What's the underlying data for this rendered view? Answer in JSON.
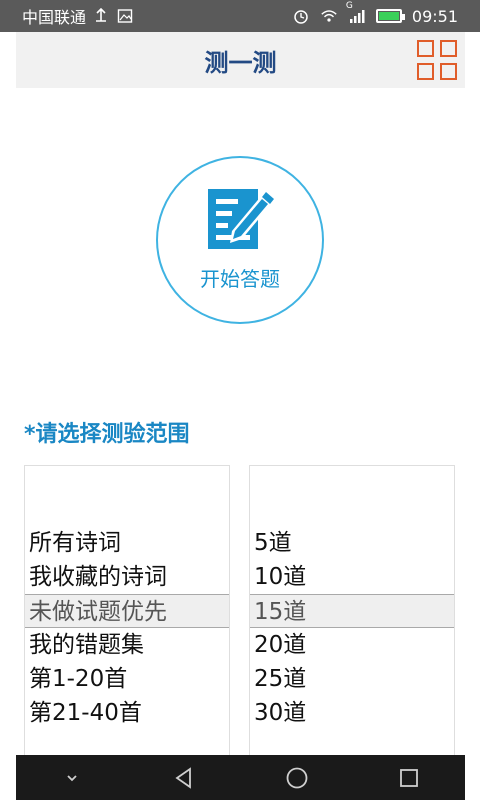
{
  "statusbar": {
    "carrier": "中国联通",
    "time": "09:51",
    "network": "G"
  },
  "header": {
    "title": "测一测"
  },
  "start": {
    "label": "开始答题"
  },
  "section": {
    "label": "*请选择测验范围"
  },
  "scope_picker": {
    "items": [
      "所有诗词",
      "我收藏的诗词",
      "未做试题优先",
      "我的错题集",
      "第1-20首",
      "第21-40首"
    ],
    "selected": "未做试题优先"
  },
  "count_picker": {
    "items": [
      "5道",
      "10道",
      "15道",
      "20道",
      "25道",
      "30道"
    ],
    "selected": "15道"
  },
  "colors": {
    "accent": "#1a87c4",
    "title": "#234a84",
    "grid_icon": "#e05d2a",
    "circle_border": "#3fb3e2"
  }
}
